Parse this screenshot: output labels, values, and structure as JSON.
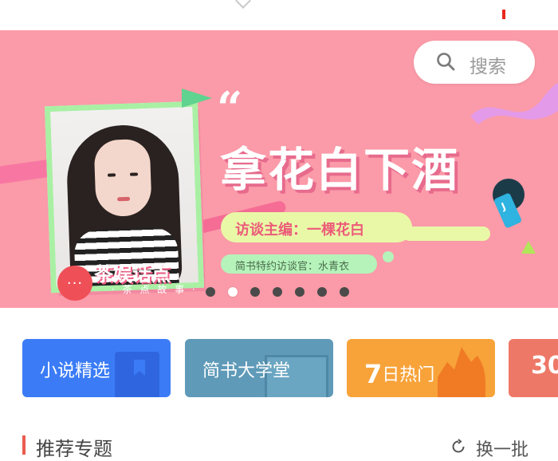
{
  "banner": {
    "title": "拿花白下酒",
    "quote_mark": "“",
    "host_line": "访谈主编：一棵花白",
    "guest_line": "简书特约访谈官：水青衣",
    "brand": "茶娱话点",
    "brand_sub": "· 茶 点 故 事 ·",
    "bubble": "···",
    "mic_letter": "J",
    "carousel": {
      "count": 7,
      "active_index": 1
    }
  },
  "search": {
    "label": "搜索",
    "icon": "search-icon"
  },
  "categories": [
    {
      "label": "小说精选",
      "color": "#3b7cf6"
    },
    {
      "label": "简书大学堂",
      "color": "#5f9ab8"
    },
    {
      "label_num": "7",
      "label_text": "日热门",
      "color": "#f7a33a"
    },
    {
      "label": "30",
      "color": "#ee7867"
    }
  ],
  "section": {
    "title": "推荐专题",
    "refresh_label": "换一批"
  },
  "colors": {
    "banner_bg": "#fb9aa8",
    "accent_red": "#ea5b4e"
  }
}
